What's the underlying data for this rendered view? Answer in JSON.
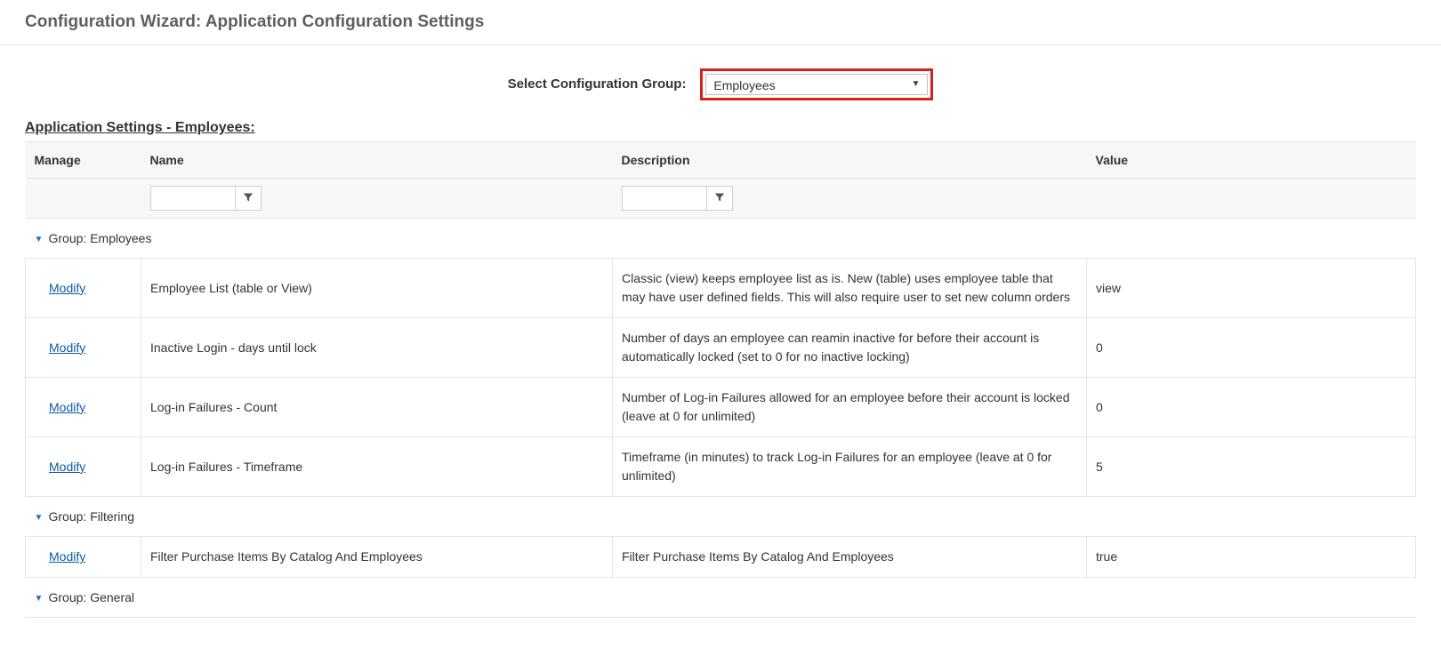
{
  "header": {
    "title": "Configuration Wizard: Application Configuration Settings"
  },
  "selector": {
    "label": "Select Configuration Group:",
    "selected": "Employees"
  },
  "subheader": "Application Settings - Employees:",
  "columns": {
    "manage": "Manage",
    "name": "Name",
    "description": "Description",
    "value": "Value"
  },
  "modify_label": "Modify",
  "groups": [
    {
      "title": "Group: Employees",
      "rows": [
        {
          "name": "Employee List (table or View)",
          "description": "Classic (view) keeps employee list as is. New (table) uses employee table that may have user defined fields. This will also require user to set new column orders",
          "value": "view"
        },
        {
          "name": "Inactive Login - days until lock",
          "description": "Number of days an employee can reamin inactive for before their account is automatically locked (set to 0 for no inactive locking)",
          "value": "0"
        },
        {
          "name": "Log-in Failures - Count",
          "description": "Number of Log-in Failures allowed for an employee before their account is locked (leave at 0 for unlimited)",
          "value": "0"
        },
        {
          "name": "Log-in Failures - Timeframe",
          "description": "Timeframe (in minutes) to track Log-in Failures for an employee (leave at 0 for unlimited)",
          "value": "5"
        }
      ]
    },
    {
      "title": "Group: Filtering",
      "rows": [
        {
          "name": "Filter Purchase Items By Catalog And Employees",
          "description": "Filter Purchase Items By Catalog And Employees",
          "value": "true"
        }
      ]
    },
    {
      "title": "Group: General",
      "rows": []
    }
  ]
}
